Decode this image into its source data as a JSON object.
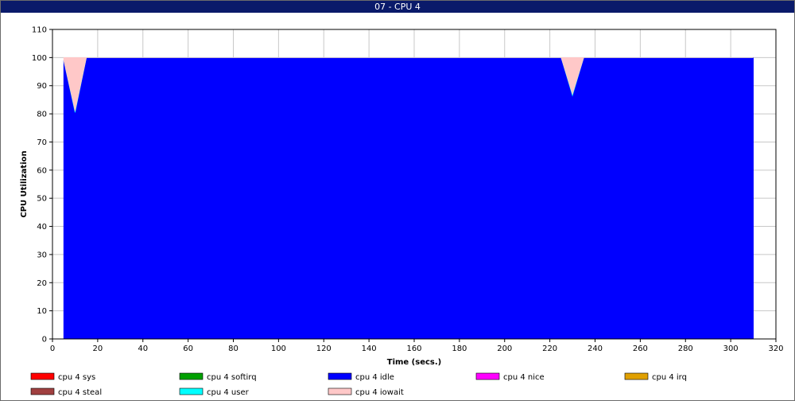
{
  "window": {
    "title": "07 - CPU 4"
  },
  "chart_data": {
    "type": "area",
    "stacked": true,
    "xlabel": "Time (secs.)",
    "ylabel": "CPU Utilization",
    "xlim": [
      0,
      320
    ],
    "ylim": [
      0,
      110
    ],
    "xticks": [
      0,
      20,
      40,
      60,
      80,
      100,
      120,
      140,
      160,
      180,
      200,
      220,
      240,
      260,
      280,
      300,
      320
    ],
    "yticks": [
      0,
      10,
      20,
      30,
      40,
      50,
      60,
      70,
      80,
      90,
      100,
      110
    ],
    "grid": true,
    "legend_position": "bottom",
    "x": [
      5,
      10,
      15,
      225,
      230,
      235,
      310
    ],
    "series": [
      {
        "name": "cpu 4 sys",
        "color": "#ff0000",
        "values": [
          0,
          0,
          0,
          0,
          0,
          0,
          0
        ]
      },
      {
        "name": "cpu 4 softirq",
        "color": "#00a000",
        "values": [
          0,
          0,
          0,
          0,
          0,
          0,
          0
        ]
      },
      {
        "name": "cpu 4 idle",
        "color": "#0000ff",
        "values": [
          99,
          80.5,
          100,
          100,
          86.5,
          100,
          100
        ]
      },
      {
        "name": "cpu 4 nice",
        "color": "#ff00ff",
        "values": [
          0,
          0,
          0,
          0,
          0,
          0,
          0
        ]
      },
      {
        "name": "cpu 4 irq",
        "color": "#e0a000",
        "values": [
          0,
          0,
          0,
          0,
          0,
          0,
          0
        ]
      },
      {
        "name": "cpu 4 steal",
        "color": "#a04040",
        "values": [
          0,
          0,
          0,
          0,
          0,
          0,
          0
        ]
      },
      {
        "name": "cpu 4 user",
        "color": "#00ffff",
        "values": [
          0,
          0.5,
          0,
          0,
          0.5,
          0,
          0
        ]
      },
      {
        "name": "cpu 4 iowait",
        "color": "#ffc8c8",
        "values": [
          1,
          19,
          0,
          0,
          13,
          0,
          0
        ]
      }
    ]
  }
}
